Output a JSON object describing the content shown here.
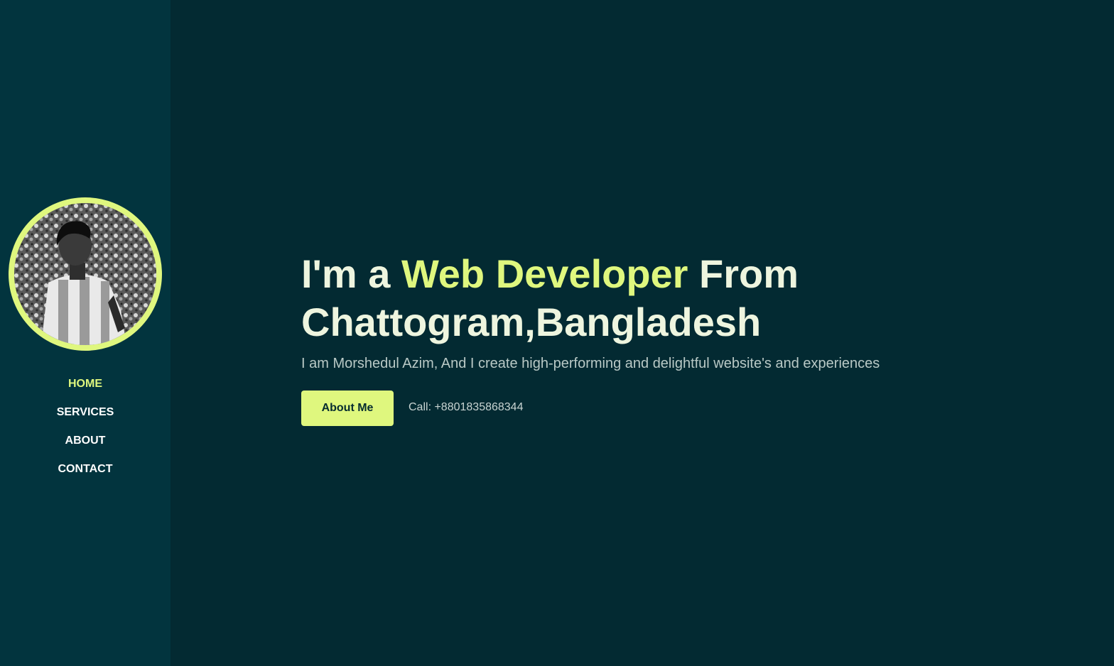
{
  "sidebar": {
    "avatar_icon": "profile-photo",
    "nav": [
      {
        "label": "HOME",
        "active": true
      },
      {
        "label": "SERVICES",
        "active": false
      },
      {
        "label": "ABOUT",
        "active": false
      },
      {
        "label": "CONTACT",
        "active": false
      }
    ]
  },
  "hero": {
    "headline_prefix": "I'm a ",
    "headline_accent": "Web Developer",
    "headline_suffix": " From Chattogram,Bangladesh",
    "tagline": "I am Morshedul Azim, And I create high-performing and delightful website's and experiences",
    "about_button": "About Me",
    "call_text": "Call: +8801835868344"
  },
  "colors": {
    "background": "#032a32",
    "sidebar": "#02343e",
    "accent": "#dff77e",
    "text": "#eef5df"
  }
}
